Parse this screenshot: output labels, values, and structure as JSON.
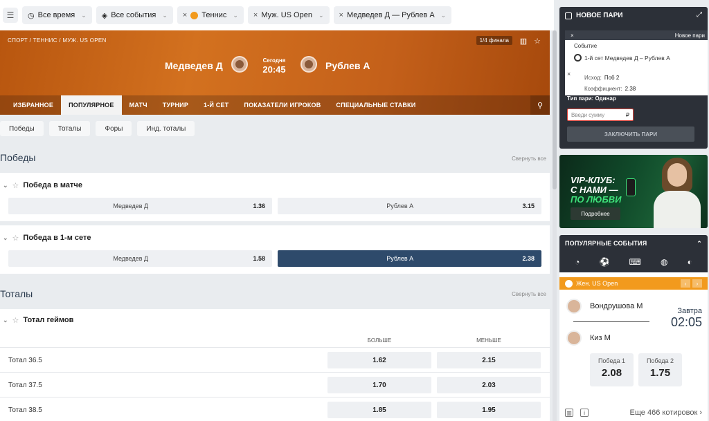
{
  "filters": {
    "menu_icon": "filter-icon",
    "time": "Все время",
    "events": "Все события",
    "sport": "Теннис",
    "tournament": "Муж. US Open",
    "match": "Медведев Д — Рублев А"
  },
  "hero": {
    "breadcrumb": "СПОРТ  /  ТЕННИС  /  МУЖ. US OPEN",
    "round": "1/4 финала",
    "player1": "Медведев Д",
    "player2": "Рублев А",
    "day": "Сегодня",
    "time": "20:45",
    "tabs": [
      "ИЗБРАННОЕ",
      "ПОПУЛЯРНОЕ",
      "МАТЧ",
      "ТУРНИР",
      "1-Й СЕТ",
      "ПОКАЗАТЕЛИ ИГРОКОВ",
      "СПЕЦИАЛЬНЫЕ СТАВКИ"
    ],
    "active_tab": "ПОПУЛЯРНОЕ"
  },
  "subtabs": [
    "Победы",
    "Тоталы",
    "Форы",
    "Инд. тоталы"
  ],
  "sections": {
    "wins_title": "Победы",
    "totals_title": "Тоталы",
    "collapse_label": "Свернуть все"
  },
  "markets": {
    "match_win": {
      "title": "Победа в матче",
      "p1": "Медведев Д",
      "p1_odd": "1.36",
      "p2": "Рублев А",
      "p2_odd": "3.15"
    },
    "set1_win": {
      "title": "Победа в 1-м сете",
      "p1": "Медведев Д",
      "p1_odd": "1.58",
      "p2": "Рублев А",
      "p2_odd": "2.38"
    },
    "games_total": {
      "title": "Тотал геймов",
      "col_over": "БОЛЬШЕ",
      "col_under": "МЕНЬШЕ",
      "rows": [
        {
          "name": "Тотал 36.5",
          "over": "1.62",
          "under": "2.15"
        },
        {
          "name": "Тотал 37.5",
          "over": "1.70",
          "under": "2.03"
        },
        {
          "name": "Тотал 38.5",
          "over": "1.85",
          "under": "1.95"
        }
      ]
    }
  },
  "slip": {
    "title": "НОВОЕ ПАРИ",
    "new_label": "Новое пари",
    "event_label": "Событие",
    "event_name": "1-й сет Медведев Д – Рублев А",
    "outcome_label": "Исход:",
    "outcome_value": "Поб 2",
    "coef_label": "Коэффициент:",
    "coef_value": "2.38",
    "bet_type": "Тип пари: Одинар",
    "stake_placeholder": "Введи сумму",
    "currency": "₽",
    "place_button": "ЗАКЛЮЧИТЬ ПАРИ"
  },
  "banner": {
    "line1": "VIP-КЛУБ:",
    "line2": "С НАМИ —",
    "line3": "ПО ЛЮБВИ",
    "button": "Подробнее"
  },
  "popular": {
    "title": "ПОПУЛЯРНЫЕ СОБЫТИЯ",
    "sport_icons": [
      "tennis-icon",
      "soccer-icon",
      "esports-icon",
      "basketball-icon",
      "table-tennis-icon"
    ],
    "league": "Жен. US Open",
    "player1": "Вондрушова М",
    "player2": "Киз М",
    "day": "Завтра",
    "time": "02:05",
    "win1_label": "Победа 1",
    "win1_odd": "2.08",
    "win2_label": "Победа 2",
    "win2_odd": "1.75",
    "more": "Еще 466 котировок"
  },
  "colors": {
    "accent_orange": "#f29a1d",
    "selected_odd": "#2e4a6b",
    "panel_dark": "#2c3038"
  }
}
